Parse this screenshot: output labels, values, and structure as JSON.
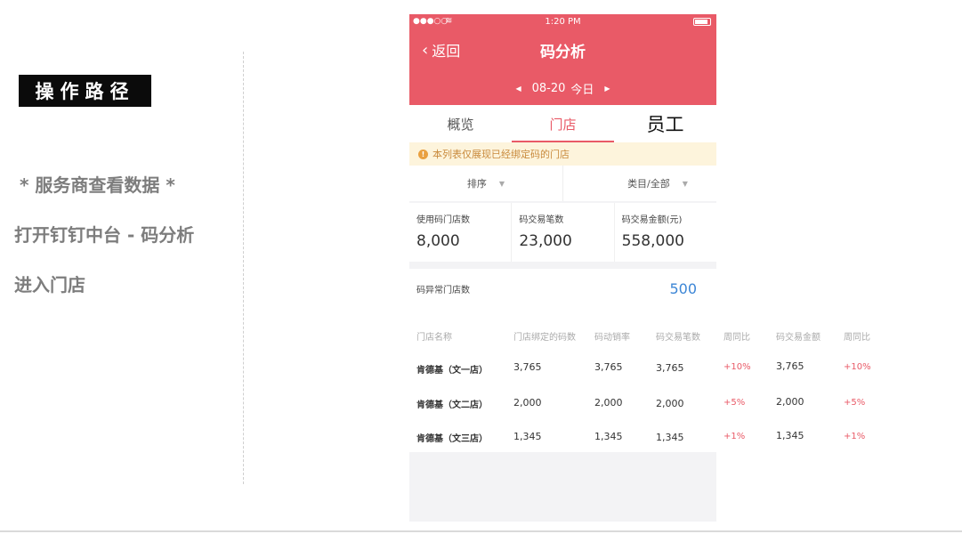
{
  "annotation": {
    "title": "操作路径",
    "steps": [
      "* 服务商查看数据 *",
      "打开钉钉中台 - 码分析",
      "进入门店"
    ]
  },
  "phone": {
    "status_bar": {
      "signal": "●●●○○",
      "time": "1:20 PM"
    },
    "nav": {
      "back_label": "返回",
      "title": "码分析"
    },
    "date": {
      "value": "08-20",
      "label": "今日"
    },
    "tabs": [
      {
        "label": "概览",
        "active": false
      },
      {
        "label": "门店",
        "active": true
      },
      {
        "label": "员工",
        "active": false
      }
    ],
    "notice": "本列表仅展现已经绑定码的门店",
    "filters": {
      "sort": "排序",
      "category": "类目/全部"
    },
    "stats": [
      {
        "label": "使用码门店数",
        "value": "8,000"
      },
      {
        "label": "码交易笔数",
        "value": "23,000"
      },
      {
        "label": "码交易金额(元)",
        "value": "558,000"
      }
    ],
    "abnormal": {
      "label": "码异常门店数",
      "value": "500"
    },
    "table": {
      "headers": [
        "门店名称",
        "门店绑定的码数",
        "码动销率",
        "码交易笔数",
        "周同比",
        "码交易金额",
        "周同比"
      ],
      "rows": [
        [
          "肯德基（文一店）",
          "3,765",
          "3,765",
          "3,765",
          "+10%",
          "3,765",
          "+10%"
        ],
        [
          "肯德基（文二店）",
          "2,000",
          "2,000",
          "2,000",
          "+5%",
          "2,000",
          "+5%"
        ],
        [
          "肯德基（文三店）",
          "1,345",
          "1,345",
          "1,345",
          "+1%",
          "1,345",
          "+1%"
        ]
      ]
    }
  },
  "colors": {
    "brand": "#e95a67",
    "link": "#3c86d6",
    "notice_bg": "#fdf4dc"
  },
  "icons": {
    "back": "chevron-left-icon",
    "prev": "triangle-left-icon",
    "next": "triangle-right-icon",
    "warn": "warning-icon",
    "dropdown": "caret-down-icon"
  }
}
